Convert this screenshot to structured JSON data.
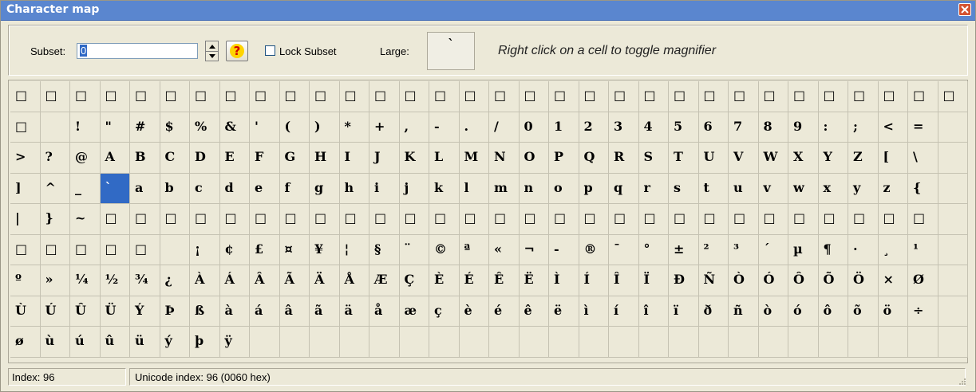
{
  "window": {
    "title": "Character map",
    "close_icon": "close-icon"
  },
  "toolbar": {
    "subset_label": "Subset:",
    "subset_value": "0",
    "help_label": "?",
    "lock_label": "Lock Subset",
    "lock_checked": false,
    "large_label": "Large:",
    "large_preview": "`",
    "hint": "Right click on a cell to toggle magnifier"
  },
  "grid": {
    "selected_index": 99,
    "cells": [
      "□",
      "□",
      "□",
      "□",
      "□",
      "□",
      "□",
      "□",
      "□",
      "□",
      "□",
      "□",
      "□",
      "□",
      "□",
      "□",
      "□",
      "□",
      "□",
      "□",
      "□",
      "□",
      "□",
      "□",
      "□",
      "□",
      "□",
      "□",
      "□",
      "□",
      "□",
      "□",
      "□",
      "",
      "!",
      "\"",
      "#",
      "$",
      "%",
      "&",
      "'",
      "(",
      ")",
      "*",
      "+",
      ",",
      "-",
      ".",
      "/",
      "0",
      "1",
      "2",
      "3",
      "4",
      "5",
      "6",
      "7",
      "8",
      "9",
      ":",
      ";",
      "<",
      "=",
      "",
      ">",
      "?",
      "@",
      "A",
      "B",
      "C",
      "D",
      "E",
      "F",
      "G",
      "H",
      "I",
      "J",
      "K",
      "L",
      "M",
      "N",
      "O",
      "P",
      "Q",
      "R",
      "S",
      "T",
      "U",
      "V",
      "W",
      "X",
      "Y",
      "Z",
      "[",
      "\\",
      "",
      "]",
      "^",
      "_",
      "`",
      "a",
      "b",
      "c",
      "d",
      "e",
      "f",
      "g",
      "h",
      "i",
      "j",
      "k",
      "l",
      "m",
      "n",
      "o",
      "p",
      "q",
      "r",
      "s",
      "t",
      "u",
      "v",
      "w",
      "x",
      "y",
      "z",
      "{",
      "",
      "|",
      "}",
      "~",
      "□",
      "□",
      "□",
      "□",
      "□",
      "□",
      "□",
      "□",
      "□",
      "□",
      "□",
      "□",
      "□",
      "□",
      "□",
      "□",
      "□",
      "□",
      "□",
      "□",
      "□",
      "□",
      "□",
      "□",
      "□",
      "□",
      "□",
      "□",
      "",
      "□",
      "□",
      "□",
      "□",
      "□",
      "",
      "¡",
      "¢",
      "£",
      "¤",
      "¥",
      "¦",
      "§",
      "¨",
      "©",
      "ª",
      "«",
      "¬",
      "-",
      "®",
      "¯",
      "°",
      "±",
      "²",
      "³",
      "´",
      "µ",
      "¶",
      "·",
      "¸",
      "¹",
      "",
      "º",
      "»",
      "¼",
      "½",
      "¾",
      "¿",
      "À",
      "Á",
      "Â",
      "Ã",
      "Ä",
      "Å",
      "Æ",
      "Ç",
      "È",
      "É",
      "Ê",
      "Ë",
      "Ì",
      "Í",
      "Î",
      "Ï",
      "Ð",
      "Ñ",
      "Ò",
      "Ó",
      "Ô",
      "Õ",
      "Ö",
      "×",
      "Ø",
      "",
      "Ù",
      "Ú",
      "Û",
      "Ü",
      "Ý",
      "Þ",
      "ß",
      "à",
      "á",
      "â",
      "ã",
      "ä",
      "å",
      "æ",
      "ç",
      "è",
      "é",
      "ê",
      "ë",
      "ì",
      "í",
      "î",
      "ï",
      "ð",
      "ñ",
      "ò",
      "ó",
      "ô",
      "õ",
      "ö",
      "÷",
      "",
      "ø",
      "ù",
      "ú",
      "û",
      "ü",
      "ý",
      "þ",
      "ÿ",
      "",
      "",
      "",
      "",
      "",
      "",
      "",
      "",
      "",
      "",
      "",
      "",
      "",
      "",
      "",
      "",
      "",
      "",
      "",
      "",
      "",
      "",
      "",
      ""
    ]
  },
  "status": {
    "index": "Index: 96",
    "unicode": "Unicode index: 96 (0060 hex)"
  }
}
